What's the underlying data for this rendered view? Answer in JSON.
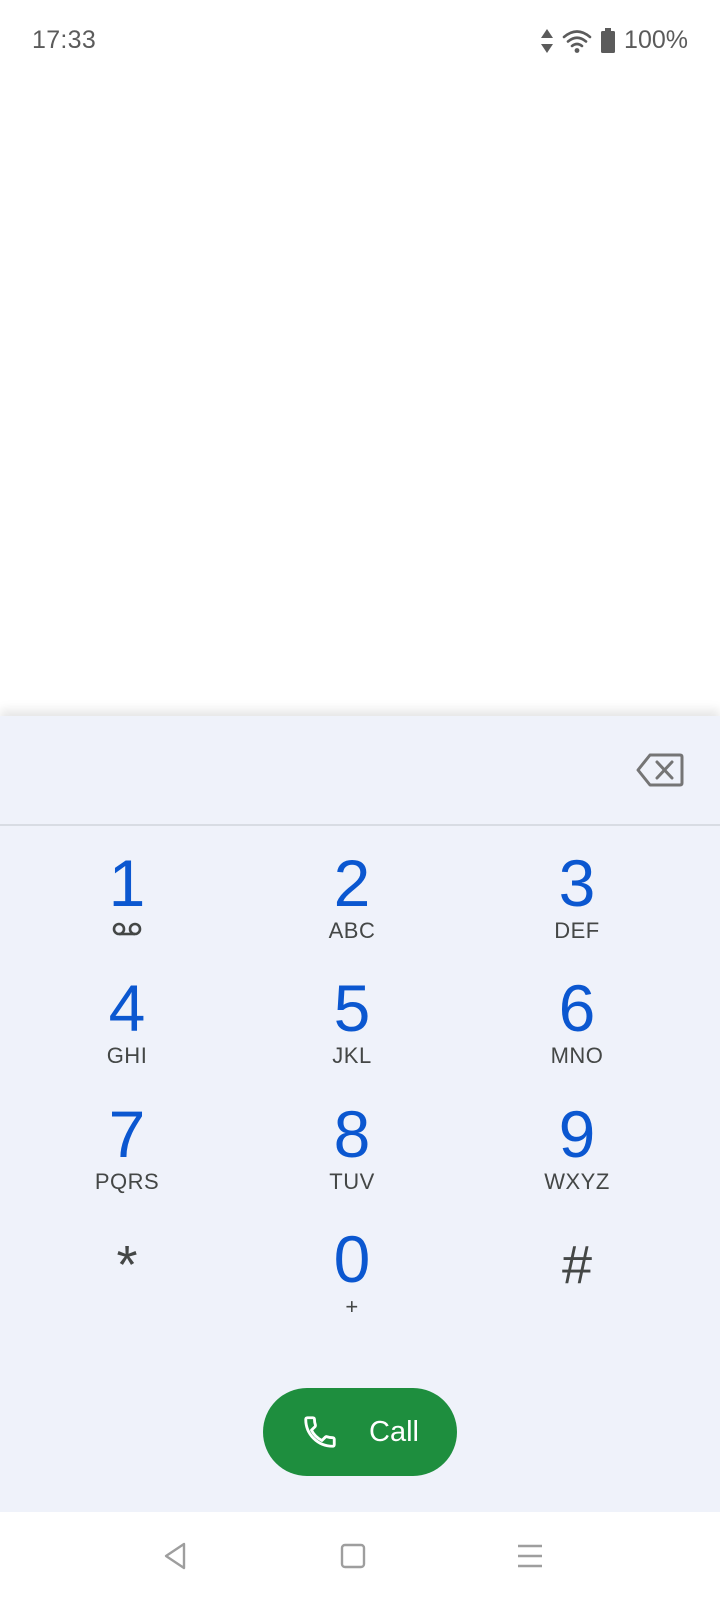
{
  "status_bar": {
    "time": "17:33",
    "battery_percent": "100%",
    "icons": [
      "data-arrows-icon",
      "wifi-icon",
      "battery-icon"
    ]
  },
  "dialer": {
    "entered_digits": "",
    "keys": [
      {
        "digit": "1",
        "letters": ""
      },
      {
        "digit": "2",
        "letters": "ABC"
      },
      {
        "digit": "3",
        "letters": "DEF"
      },
      {
        "digit": "4",
        "letters": "GHI"
      },
      {
        "digit": "5",
        "letters": "JKL"
      },
      {
        "digit": "6",
        "letters": "MNO"
      },
      {
        "digit": "7",
        "letters": "PQRS"
      },
      {
        "digit": "8",
        "letters": "TUV"
      },
      {
        "digit": "9",
        "letters": "WXYZ"
      },
      {
        "digit": "*",
        "letters": ""
      },
      {
        "digit": "0",
        "letters": "+"
      },
      {
        "digit": "#",
        "letters": ""
      }
    ],
    "call_label": "Call"
  },
  "colors": {
    "digit_blue": "#0b57d0",
    "call_green": "#1e8e3e",
    "sheet_background": "#eff2fa"
  }
}
